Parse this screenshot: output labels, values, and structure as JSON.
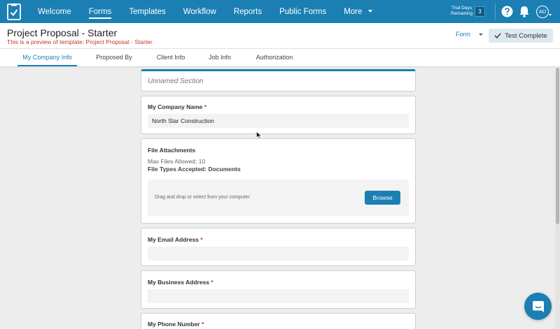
{
  "nav": {
    "items": [
      "Welcome",
      "Forms",
      "Templates",
      "Workflow",
      "Reports",
      "Public Forms",
      "More"
    ],
    "trial_label": "Trial Days Remaining",
    "trial_count": "3",
    "avatar_initials": "AD"
  },
  "header": {
    "title": "Project Proposal - Starter",
    "preview_note": "This is a preview of template: Project Proposal - Starter",
    "form_dropdown": "Form",
    "test_button": "Test Complete"
  },
  "tabs": [
    "My Company Info",
    "Proposed By",
    "Client Info",
    "Job Info",
    "Authorization"
  ],
  "section": {
    "title": "Unnamed Section"
  },
  "fields": {
    "company_name": {
      "label": "My Company Name",
      "value": "North Star Construction"
    },
    "attachments": {
      "label": "File Attachments",
      "max_files": "Max Files Allowed: 10",
      "types": "File Types Accepted: Documents",
      "drop_text": "Drag and drop or select from your computer",
      "browse": "Browse"
    },
    "email": {
      "label": "My Email Address",
      "value": ""
    },
    "business_address": {
      "label": "My Business Address",
      "value": ""
    },
    "phone": {
      "label": "My Phone Number"
    }
  },
  "required_marker": "*",
  "colors": {
    "accent": "#1b7fb3",
    "required": "#c0392b"
  }
}
